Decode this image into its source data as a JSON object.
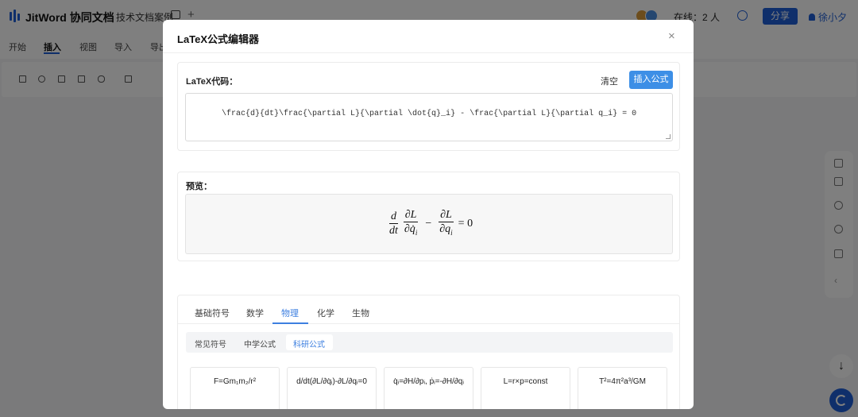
{
  "app": {
    "name": "JitWord 协同文档",
    "doc_name": "技术文档案例",
    "online": "在线：2 人",
    "share_label": "分享",
    "user_name": "徐小夕",
    "menu": [
      "开始",
      "插入",
      "视图",
      "导入",
      "导出"
    ],
    "active_menu": "插入"
  },
  "modal": {
    "title": "LaTeX公式编辑器",
    "code_label": "LaTeX代码：",
    "clear_label": "清空",
    "insert_label": "插入公式",
    "code_value": "\\frac{d}{dt}\\frac{\\partial L}{\\partial \\dot{q}_i} - \\frac{\\partial L}{\\partial q_i} = 0",
    "preview_label": "预览：",
    "preview": {
      "d": "d",
      "dt": "dt",
      "dL": "∂L",
      "dqdot": "∂q̇",
      "i": "i",
      "minus": "−",
      "dL2": "∂L",
      "dq": "∂q",
      "i2": "i",
      "eq": "= 0"
    },
    "tabs": [
      "基础符号",
      "数学",
      "物理",
      "化学",
      "生物"
    ],
    "active_tab": "物理",
    "subtabs": [
      "常见符号",
      "中学公式",
      "科研公式"
    ],
    "active_subtab": "科研公式",
    "formula_cards": [
      "F=Gm₁m₂/r²",
      "d/dt(∂L/∂q̇ᵢ)-∂L/∂qᵢ=0",
      "q̇ᵢ=∂H/∂pᵢ, ṗᵢ=-∂H/∂qᵢ",
      "L=r×p=const",
      "T²=4π²a³/GM"
    ]
  },
  "colors": {
    "brand": "#1f5fd6",
    "accent": "#3d8fe6",
    "overlay": "rgba(0,0,0,0.5)"
  }
}
